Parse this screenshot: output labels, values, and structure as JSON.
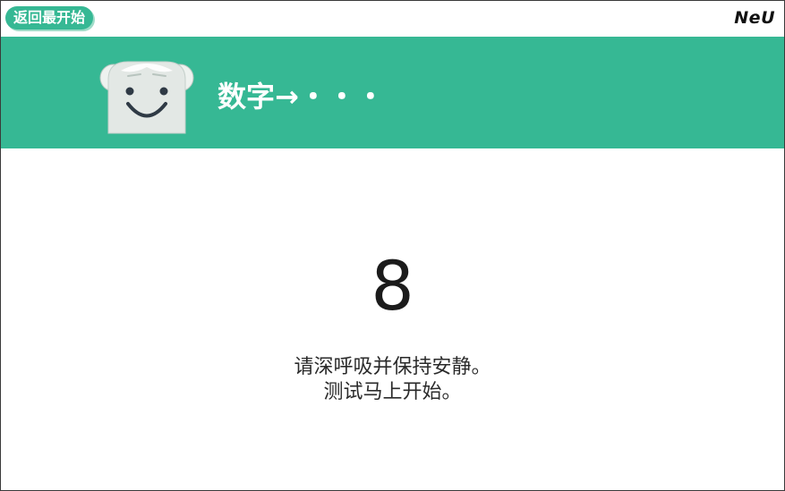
{
  "topbar": {
    "back_label": "返回最开始",
    "brand": "NeU"
  },
  "header": {
    "title": "数字→・・・",
    "accent_color": "#36b894"
  },
  "main": {
    "countdown": "8",
    "instruction_line1": "请深呼吸并保持安静。",
    "instruction_line2": "测试马上开始。"
  },
  "icons": {
    "mascot": "smiling-robot-mascot-icon"
  }
}
